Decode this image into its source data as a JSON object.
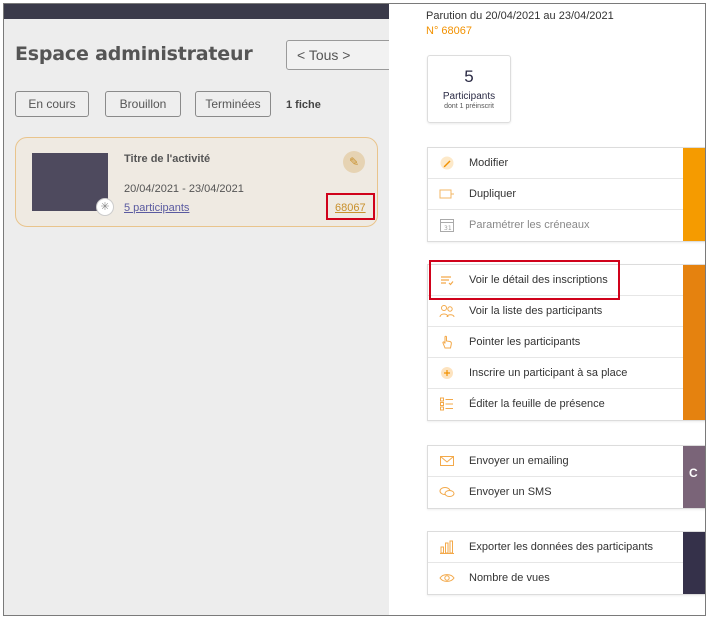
{
  "left": {
    "title": "Espace administrateur",
    "select_value": "< Tous >",
    "filters": [
      "En cours",
      "Brouillon",
      "Terminées"
    ],
    "count": "1 fiche",
    "card": {
      "title": "Titre de l'activité",
      "dates": "20/04/2021 - 23/04/2021",
      "participants": "5 participants",
      "ref": "68067"
    }
  },
  "panel": {
    "parution": "Parution du 20/04/2021 au 23/04/2021",
    "numero": "N° 68067",
    "stat": {
      "value": "5",
      "label": "Participants",
      "sub": "dont 1 préinscrit"
    },
    "groups": [
      {
        "color": "#f59b00",
        "items": [
          {
            "label": "Modifier",
            "icon": "pencil-icon"
          },
          {
            "label": "Dupliquer",
            "icon": "duplicate-icon"
          },
          {
            "label": "Paramétrer les créneaux",
            "icon": "calendar-icon",
            "disabled": true
          }
        ]
      },
      {
        "color": "#e5820f",
        "items": [
          {
            "label": "Voir le détail des inscriptions",
            "icon": "list-detail-icon"
          },
          {
            "label": "Voir la liste des participants",
            "icon": "users-icon"
          },
          {
            "label": "Pointer les participants",
            "icon": "hand-pointer-icon"
          },
          {
            "label": "Inscrire un participant à sa place",
            "icon": "plus-circle-icon"
          },
          {
            "label": "Éditer la feuille de présence",
            "icon": "checklist-icon"
          }
        ]
      },
      {
        "color": "#7a6478",
        "items": [
          {
            "label": "Envoyer un emailing",
            "icon": "envelope-icon"
          },
          {
            "label": "Envoyer un SMS",
            "icon": "chat-icon"
          }
        ]
      },
      {
        "color": "#35314a",
        "items": [
          {
            "label": "Exporter les données des participants",
            "icon": "bar-chart-icon"
          },
          {
            "label": "Nombre de vues",
            "icon": "eye-icon"
          }
        ]
      }
    ],
    "strip_glyph": "C",
    "accent": "#f29100"
  }
}
